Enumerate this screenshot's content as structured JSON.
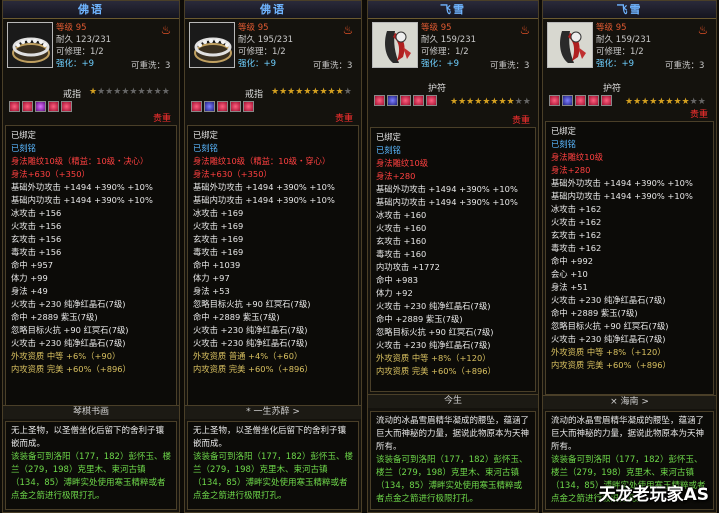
{
  "panels": [
    {
      "name": "佛语",
      "stats": {
        "level": "等级 95",
        "durability": "耐久 123/231",
        "repair": "可修理：1/2",
        "reinforce": "可重洗：3",
        "enhance": "强化：+9"
      },
      "type": "戒指",
      "stars": 1,
      "gems": [
        "r",
        "r",
        "p",
        "r",
        "r"
      ],
      "rarity": "贵重",
      "attrs": [
        [
          "w",
          "已绑定"
        ],
        [
          "c",
          "已刻铭"
        ],
        [
          "r",
          "身法雕纹10级（精益：10级・决心）"
        ],
        [
          "r",
          "身法+630（+350）"
        ],
        [
          "w",
          "基础外功攻击 +1494 +390% +10%"
        ],
        [
          "w",
          "基础内功攻击 +1494 +390% +10%"
        ],
        [
          "w",
          "冰攻击 +156"
        ],
        [
          "w",
          "火攻击 +156"
        ],
        [
          "w",
          "玄攻击 +156"
        ],
        [
          "w",
          "毒攻击 +156"
        ],
        [
          "w",
          "命中 +957"
        ],
        [
          "w",
          "体力 +99"
        ],
        [
          "w",
          "身法 +49"
        ],
        [
          "w",
          "火攻击 +230 纯净红晶石(7级)"
        ],
        [
          "w",
          "命中 +2889 紫玉(7级)"
        ],
        [
          "w",
          "忽略目标火抗 +90 红冥石(7级)"
        ],
        [
          "w",
          "火攻击 +230 纯净红晶石(7级)"
        ],
        [
          "ye",
          "外攻资质    中等 +6%（+90）"
        ],
        [
          "ye",
          "内攻资质    完美 +60%（+896）"
        ]
      ],
      "footer": "琴棋书画",
      "desc": [
        [
          "dw",
          "无上圣物，以圣僧坐化后留下的舍利子镶嵌而成。"
        ],
        [
          "dg",
          "该装备可到洛阳（177，182）彭怀玉、楼兰（279，198）克里木、束河古镇（134，85）溥畔实处使用寒玉精粹或者点金之箭进行极限打孔。"
        ]
      ]
    },
    {
      "name": "佛语",
      "stats": {
        "level": "等级 95",
        "durability": "耐久 195/231",
        "repair": "可修理：1/2",
        "reinforce": "可重洗：3",
        "enhance": "强化：+9"
      },
      "type": "戒指",
      "stars": 9,
      "gems": [
        "r",
        "b",
        "r",
        "r",
        "r"
      ],
      "rarity": "贵重",
      "attrs": [
        [
          "w",
          "已绑定"
        ],
        [
          "c",
          "已刻铭"
        ],
        [
          "r",
          "身法雕纹10级（精益：10级・穿心）"
        ],
        [
          "r",
          "身法+630（+350）"
        ],
        [
          "w",
          "基础外功攻击 +1494 +390% +10%"
        ],
        [
          "w",
          "基础内功攻击 +1494 +390% +10%"
        ],
        [
          "w",
          "冰攻击 +169"
        ],
        [
          "w",
          "火攻击 +169"
        ],
        [
          "w",
          "玄攻击 +169"
        ],
        [
          "w",
          "毒攻击 +169"
        ],
        [
          "w",
          "命中 +1039"
        ],
        [
          "w",
          "体力 +97"
        ],
        [
          "w",
          "身法 +53"
        ],
        [
          "w",
          "忽略目标火抗 +90 红冥石(7级)"
        ],
        [
          "w",
          "命中 +2889 紫玉(7级)"
        ],
        [
          "w",
          "火攻击 +230 纯净红晶石(7级)"
        ],
        [
          "w",
          "火攻击 +230 纯净红晶石(7级)"
        ],
        [
          "ye",
          "外攻资质    普通 +4%（+60）"
        ],
        [
          "ye",
          "内攻资质    完美 +60%（+896）"
        ]
      ],
      "footer": "* 一生苏醉 >",
      "desc": [
        [
          "dw",
          "无上圣物，以圣僧坐化后留下的舍利子镶嵌而成。"
        ],
        [
          "dg",
          "该装备可到洛阳（177，182）彭怀玉、楼兰（279，198）克里木、束河古镇（134，85）溥畔实处使用寒玉精粹或者点金之箭进行极限打孔。"
        ]
      ]
    },
    {
      "name": "飞雪",
      "stats": {
        "level": "等级 95",
        "durability": "耐久 159/231",
        "repair": "可修理：1/2",
        "reinforce": "可重洗：3",
        "enhance": "强化：+9"
      },
      "type": "护符",
      "stars": 8,
      "gems": [
        "r",
        "b",
        "r",
        "r",
        "r"
      ],
      "rarity": "贵重",
      "attrs": [
        [
          "w",
          "已绑定"
        ],
        [
          "c",
          "已刻铭"
        ],
        [
          "r",
          "身法雕纹10级"
        ],
        [
          "r",
          "身法+280"
        ],
        [
          "w",
          "基础外功攻击 +1494 +390% +10%"
        ],
        [
          "w",
          "基础内功攻击 +1494 +390% +10%"
        ],
        [
          "w",
          "冰攻击 +160"
        ],
        [
          "w",
          "火攻击 +160"
        ],
        [
          "w",
          "玄攻击 +160"
        ],
        [
          "w",
          "毒攻击 +160"
        ],
        [
          "w",
          "内功攻击 +1772"
        ],
        [
          "w",
          "命中 +983"
        ],
        [
          "w",
          "体力 +92"
        ],
        [
          "w",
          "火攻击 +230 纯净红晶石(7级)"
        ],
        [
          "w",
          "命中 +2889 紫玉(7级)"
        ],
        [
          "w",
          "忽略目标火抗 +90 红冥石(7级)"
        ],
        [
          "w",
          "火攻击 +230 纯净红晶石(7级)"
        ],
        [
          "ye",
          "外攻资质    中等 +8%（+120）"
        ],
        [
          "ye",
          "内攻资质    完美 +60%（+896）"
        ]
      ],
      "footer": "今生",
      "desc": [
        [
          "dw",
          "流动的冰晶雪眉精华凝成的腰坠，蕴涵了巨大而神秘的力量，据说此物原本为天神所有。"
        ],
        [
          "dg",
          "该装备可到洛阳（177，182）彭怀玉、楼兰（279，198）克里木、束河古镇（134，85）溥畔实处使用寒玉精粹或者点金之箭进行极限打孔。"
        ]
      ]
    },
    {
      "name": "飞雪",
      "stats": {
        "level": "等级 95",
        "durability": "耐久 159/231",
        "repair": "可修理：1/2",
        "reinforce": "可重洗：3",
        "enhance": "强化：+9"
      },
      "type": "护符",
      "stars": 8,
      "gems": [
        "r",
        "b",
        "r",
        "r",
        "r"
      ],
      "rarity": "贵重",
      "attrs": [
        [
          "w",
          "已绑定"
        ],
        [
          "c",
          "已刻铭"
        ],
        [
          "r",
          "身法雕纹10级"
        ],
        [
          "r",
          "身法+280"
        ],
        [
          "w",
          "基础外功攻击 +1494 +390% +10%"
        ],
        [
          "w",
          "基础内功攻击 +1494 +390% +10%"
        ],
        [
          "w",
          "冰攻击 +162"
        ],
        [
          "w",
          "火攻击 +162"
        ],
        [
          "w",
          "玄攻击 +162"
        ],
        [
          "w",
          "毒攻击 +162"
        ],
        [
          "w",
          "命中 +992"
        ],
        [
          "w",
          "会心 +10"
        ],
        [
          "w",
          "身法 +51"
        ],
        [
          "w",
          "火攻击 +230 纯净红晶石(7级)"
        ],
        [
          "w",
          "命中 +2889 紫玉(7级)"
        ],
        [
          "w",
          "忽略目标火抗 +90 红冥石(7级)"
        ],
        [
          "w",
          "火攻击 +230 纯净红晶石(7级)"
        ],
        [
          "ye",
          "外攻资质    中等 +8%（+120）"
        ],
        [
          "ye",
          "内攻资质    完美 +60%（+896）"
        ]
      ],
      "footer": "× 海南 >",
      "desc": [
        [
          "dw",
          "流动的冰晶雪眉精华凝成的腰坠，蕴涵了巨大而神秘的力量，据说此物原本为天神所有。"
        ],
        [
          "dg",
          "该装备可到洛阳（177，182）彭怀玉、楼兰（279，198）克里木、束河古镇（134，85）溥畔实处使用寒玉精粹或者点金之箭进行极限打孔。"
        ]
      ]
    }
  ],
  "watermark": "天龙老玩家AS"
}
